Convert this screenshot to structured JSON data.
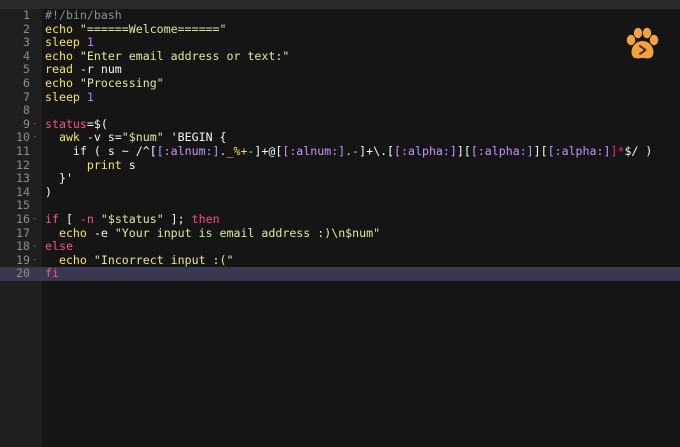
{
  "editor": {
    "lines": [
      {
        "n": "1",
        "fold": "",
        "tokens": [
          {
            "t": "#!/bin/bash",
            "c": "comment"
          }
        ]
      },
      {
        "n": "2",
        "fold": "",
        "tokens": [
          {
            "t": "echo ",
            "c": "builtin"
          },
          {
            "t": "\"======Welcome======\"",
            "c": "string"
          }
        ]
      },
      {
        "n": "3",
        "fold": "",
        "tokens": [
          {
            "t": "sleep ",
            "c": "builtin"
          },
          {
            "t": "1",
            "c": "number"
          }
        ]
      },
      {
        "n": "4",
        "fold": "",
        "tokens": [
          {
            "t": "echo ",
            "c": "builtin"
          },
          {
            "t": "\"Enter email address or text:\"",
            "c": "string"
          }
        ]
      },
      {
        "n": "5",
        "fold": "",
        "tokens": [
          {
            "t": "read ",
            "c": "builtin"
          },
          {
            "t": "-r num",
            "c": "plain"
          }
        ]
      },
      {
        "n": "6",
        "fold": "",
        "tokens": [
          {
            "t": "echo ",
            "c": "builtin"
          },
          {
            "t": "\"Processing\"",
            "c": "string"
          }
        ]
      },
      {
        "n": "7",
        "fold": "",
        "tokens": [
          {
            "t": "sleep ",
            "c": "builtin"
          },
          {
            "t": "1",
            "c": "number"
          }
        ]
      },
      {
        "n": "8",
        "fold": "",
        "tokens": []
      },
      {
        "n": "9",
        "fold": "-",
        "tokens": [
          {
            "t": "status",
            "c": "keyword"
          },
          {
            "t": "=$(",
            "c": "plain"
          }
        ]
      },
      {
        "n": "10",
        "fold": "-",
        "tokens": [
          {
            "t": "  awk ",
            "c": "builtin"
          },
          {
            "t": "-v s=",
            "c": "plain"
          },
          {
            "t": "\"$num\"",
            "c": "string"
          },
          {
            "t": " 'BEGIN {",
            "c": "plain"
          }
        ]
      },
      {
        "n": "11",
        "fold": "",
        "tokens": [
          {
            "t": "    if ( s ~ /^[",
            "c": "plain"
          },
          {
            "t": "[:alnum:]",
            "c": "class"
          },
          {
            "t": "._%+-",
            "c": "regex"
          },
          {
            "t": "]+@[",
            "c": "plain"
          },
          {
            "t": "[:alnum:]",
            "c": "class"
          },
          {
            "t": ".-",
            "c": "regex"
          },
          {
            "t": "]+\\.[",
            "c": "plain"
          },
          {
            "t": "[:alpha:]",
            "c": "class"
          },
          {
            "t": "][",
            "c": "plain"
          },
          {
            "t": "[:alpha:]",
            "c": "class"
          },
          {
            "t": "][",
            "c": "plain"
          },
          {
            "t": "[:alpha:]",
            "c": "class"
          },
          {
            "t": "]*",
            "c": "op"
          },
          {
            "t": "$/ )",
            "c": "plain"
          }
        ]
      },
      {
        "n": "12",
        "fold": "",
        "tokens": [
          {
            "t": "      print ",
            "c": "builtin"
          },
          {
            "t": "s",
            "c": "plain"
          }
        ]
      },
      {
        "n": "13",
        "fold": "",
        "tokens": [
          {
            "t": "  }'",
            "c": "plain"
          }
        ]
      },
      {
        "n": "14",
        "fold": "",
        "tokens": [
          {
            "t": ")",
            "c": "plain"
          }
        ]
      },
      {
        "n": "15",
        "fold": "",
        "tokens": []
      },
      {
        "n": "16",
        "fold": "-",
        "tokens": [
          {
            "t": "if ",
            "c": "keyword"
          },
          {
            "t": "[ ",
            "c": "plain"
          },
          {
            "t": "-n ",
            "c": "keyword"
          },
          {
            "t": "\"$status\"",
            "c": "string"
          },
          {
            "t": " ]; ",
            "c": "plain"
          },
          {
            "t": "then",
            "c": "keyword"
          }
        ]
      },
      {
        "n": "17",
        "fold": "",
        "tokens": [
          {
            "t": "  echo ",
            "c": "builtin"
          },
          {
            "t": "-e ",
            "c": "plain"
          },
          {
            "t": "\"Your input is email address :)\\n$num\"",
            "c": "string"
          }
        ]
      },
      {
        "n": "18",
        "fold": "-",
        "tokens": [
          {
            "t": "else",
            "c": "keyword"
          }
        ]
      },
      {
        "n": "19",
        "fold": "-",
        "tokens": [
          {
            "t": "  echo ",
            "c": "builtin"
          },
          {
            "t": "\"Incorrect input :(\"",
            "c": "string"
          }
        ]
      },
      {
        "n": "20",
        "fold": "",
        "active": true,
        "tokens": [
          {
            "t": "fi",
            "c": "keyword"
          }
        ]
      }
    ]
  },
  "icons": {
    "logo": "paw-play-logo-icon"
  },
  "colors": {
    "background": "#151515",
    "gutter": "#1f1f1f",
    "active_line": "#3a3850",
    "logo": "#f3a23f"
  }
}
